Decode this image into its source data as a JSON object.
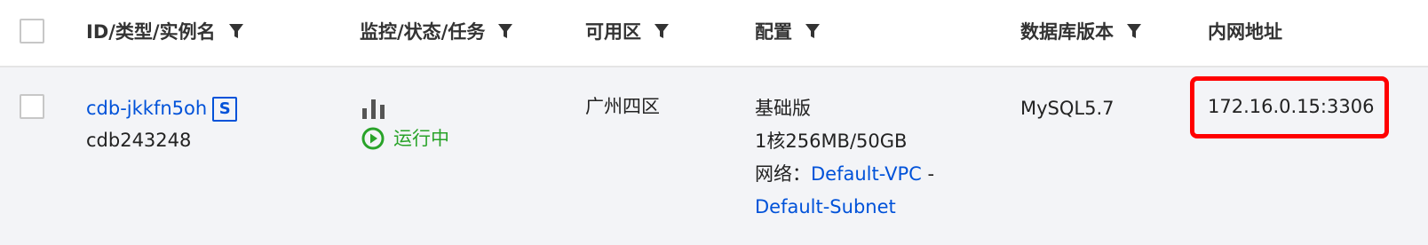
{
  "header": {
    "col_id": "ID/类型/实例名",
    "col_monitor": "监控/状态/任务",
    "col_zone": "可用区",
    "col_config": "配置",
    "col_db_version": "数据库版本",
    "col_private_addr": "内网地址"
  },
  "row": {
    "instance_id": "cdb-jkkfn5oh",
    "type_badge": "S",
    "instance_name": "cdb243248",
    "status": "运行中",
    "zone": "广州四区",
    "config_edition": "基础版",
    "config_spec": "1核256MB/50GB",
    "network_label": "网络：",
    "vpc": "Default-VPC",
    "separator": "-",
    "subnet": "Default-Subnet",
    "db_version": "MySQL5.7",
    "private_address": "172.16.0.15:3306"
  },
  "colors": {
    "link": "#0052d9",
    "status_running": "#29a329",
    "highlight": "#ff0000",
    "row_bg": "#f3f4f7"
  }
}
